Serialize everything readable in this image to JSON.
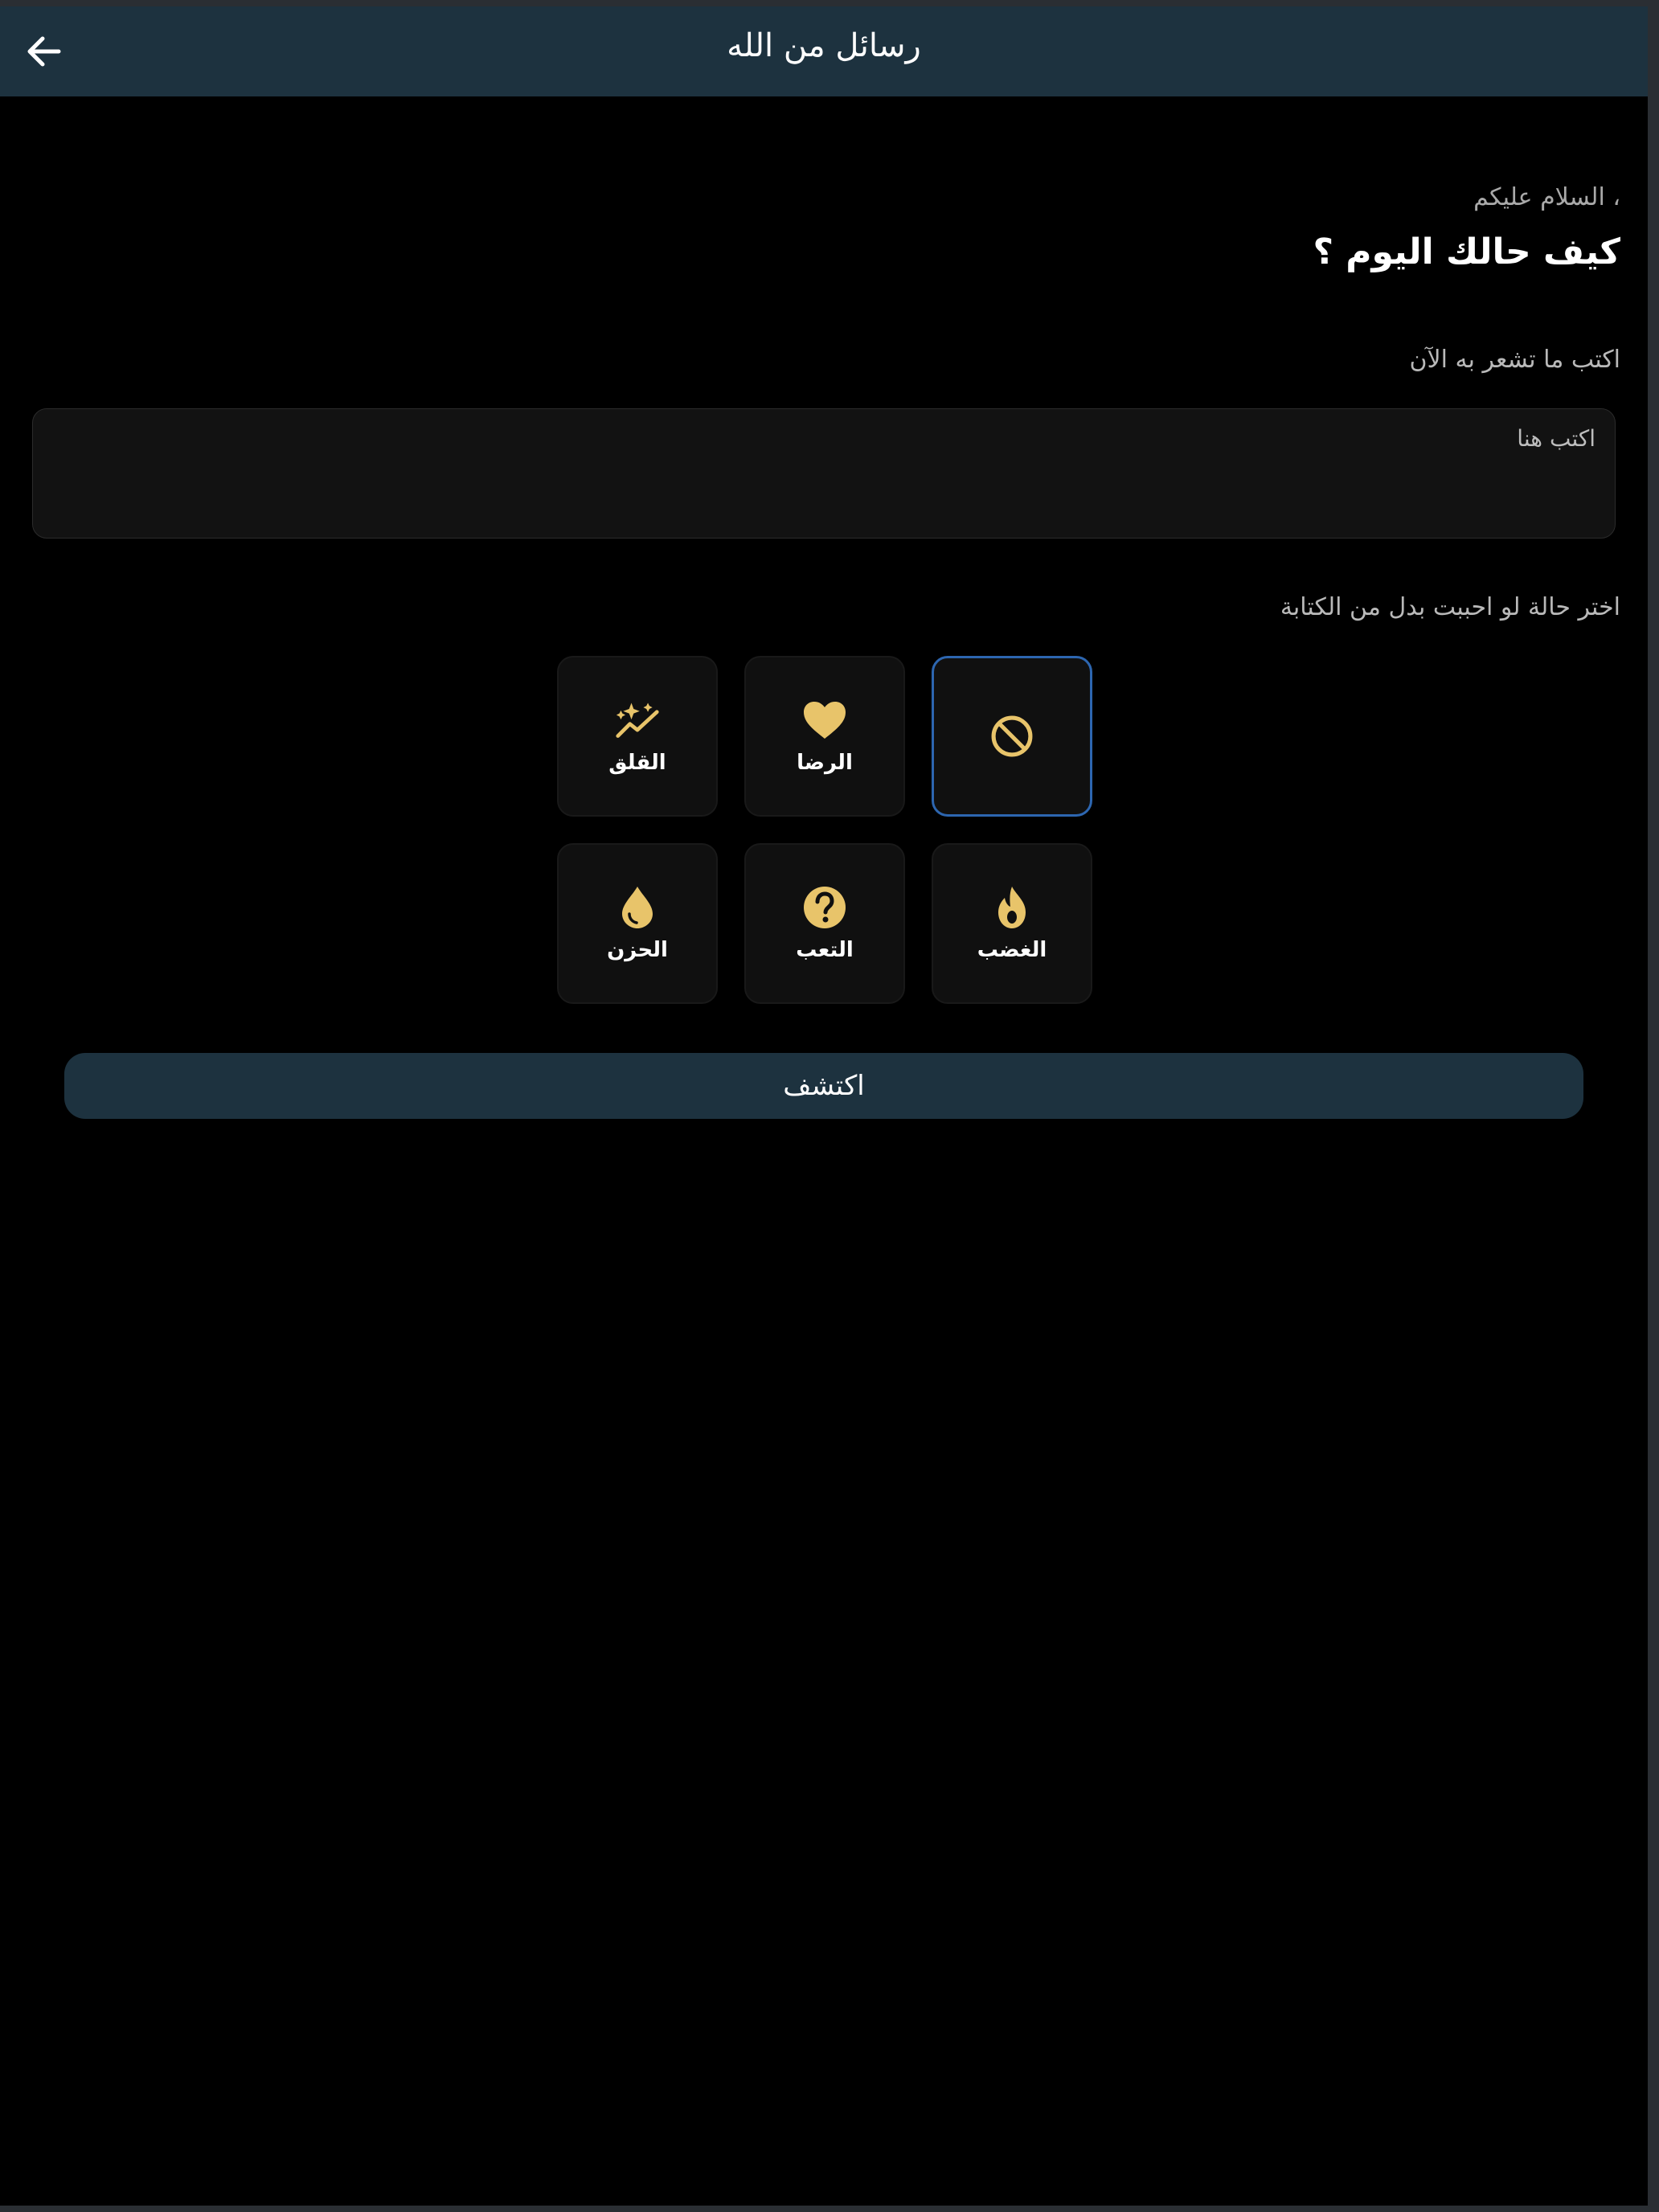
{
  "appbar": {
    "title": "رسائل من الله",
    "back_icon": "arrow-left-icon"
  },
  "greeting": "، السلام عليكم",
  "question": "كيف حالك اليوم ؟",
  "input": {
    "label": "اكتب ما تشعر به الآن",
    "placeholder": "اكتب هنا"
  },
  "mood": {
    "label": "اختر حالة لو احببت بدل من الكتابة",
    "options": [
      {
        "label": "",
        "icon": "no-selection-icon",
        "selected": true
      },
      {
        "label": "الرضا",
        "icon": "heart-icon",
        "selected": false
      },
      {
        "label": "القلق",
        "icon": "sparkles-icon",
        "selected": false
      },
      {
        "label": "الغضب",
        "icon": "flame-icon",
        "selected": false
      },
      {
        "label": "التعب",
        "icon": "question-circle-icon",
        "selected": false
      },
      {
        "label": "الحزن",
        "icon": "drop-icon",
        "selected": false
      }
    ]
  },
  "button": {
    "label": "اكتشف"
  },
  "colors": {
    "appbar": "#1d323f",
    "accent_icon": "#e8c46a",
    "selected_border": "#2d66b0",
    "background": "#000000"
  }
}
